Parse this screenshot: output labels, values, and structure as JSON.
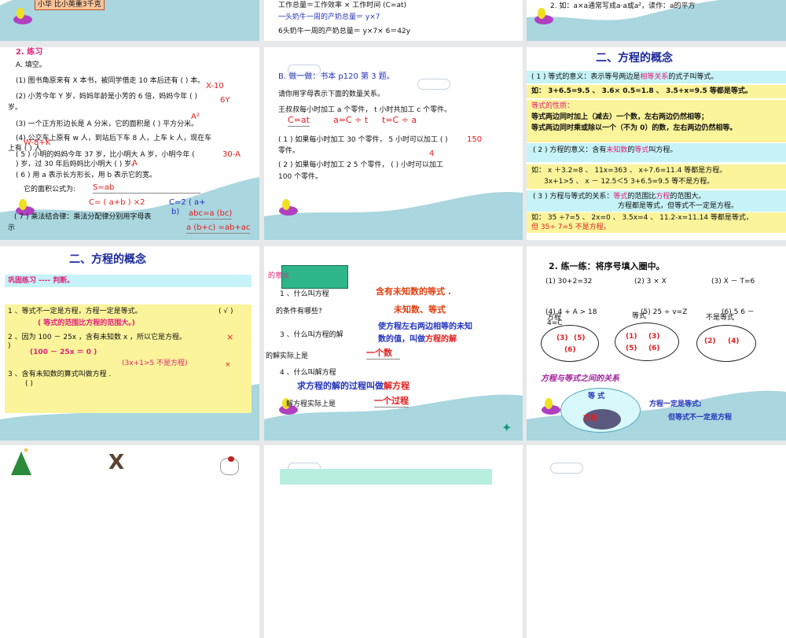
{
  "colors": {
    "wave": "#a9d6df",
    "background": "#e6e8e9",
    "cyan_band": "#c6f3f7",
    "yellow_band": "#fbf49a",
    "red": "#e02020",
    "blue": "#2233bb",
    "pink": "#e0207a"
  },
  "top_row": {
    "s1": {
      "box": "小华 比小英重3千克"
    },
    "s2": {
      "l1": "工作总量＝工作效率 × 工作时间 (C=at)",
      "l2": "一头奶牛一周的产奶总量＝  y×7",
      "l3": "6头奶牛一周的产奶总量＝  y×7× 6＝42y"
    },
    "s3": {
      "l1": "2. 如：a×a通常写成a·a或a²，读作：a的平方"
    }
  },
  "slide_practice": {
    "heading": "2. 练习",
    "sub": "A. 填空。",
    "q1": "(1) 图书角原来有 X 本书，被同学借走 10 本后还有 (        ) 本。",
    "q2": "(2) 小芳今年 Y 岁，妈妈年龄是小芳的 6 倍，妈妈今年 (       )",
    "q2b": "岁。",
    "q3": "(3) 一个正方形边长是     A 分米，它的面积是 (      ) 平方分米。",
    "q4": "(4) 公交车上原有 w 人，到站后下车 8 人，上车 k 人，现在车",
    "q4b": "上有 (              ) 人",
    "q5": "( 5 ) 小明的妈妈今年 37 岁，比小明大 A 岁，小明今年 (",
    "q5b": ") 岁，过 30 年后妈妈比小明大 (          ) 岁。",
    "q6": "( 6 ) 用 a 表示长方形长，用      b 表示它的宽。",
    "q6b": "它的面积公式为:",
    "q7": "( 7 ) 乘法结合律：乘法分配律分别用字母表",
    "q7b": "示",
    "answers": {
      "a1": "X-10",
      "a2": "6Y",
      "a3": "A²",
      "a4": "W-8+K",
      "a5": "30-A",
      "a5b": "A",
      "a6": "S=ab",
      "a6b": "C= ( a+b ) ×2",
      "a6c": "C=2 ( a+",
      "a6d": "b)",
      "a7": "abc=a (bc)",
      "a7b": "a (b+c) =ab+ac"
    }
  },
  "slide_do": {
    "heading": "B. 做一做：书本 p120 第 3 题。",
    "l1": "请你用字母表示下面的数量关系。",
    "l2": "王叔叔每小时加工 a 个零件， t 小时共加工 c 个零件。",
    "formulas": [
      "C=at",
      "a=C ÷ t",
      "t=C ÷ a"
    ],
    "q1": "( 1 ) 如果每小时加工 30 个零件， 5 小时可以加工 (        )",
    "q1b": "零件。",
    "q2": "( 2 ) 如果每小时加工 2 5 个零件， (      ) 小时可以加工",
    "q2b": "100 个零件。",
    "a1": "150",
    "a2": "4"
  },
  "slide_concept": {
    "title": "二、方程的概念",
    "p1a": "( 1 ) 等式的意义：表示等号两边是",
    "p1b": "相等关系",
    "p1c": "的式子叫等式。",
    "ex1": "如： 3+6.5=9.5 、   3.6× 0.5=1.8 、   3.5+x=9.5 等都是等式。",
    "prop_title": "等式的性质：",
    "prop1": "等式两边同时加上（减去）一个数，左右两边仍然相等；",
    "prop2": "等式两边同时乘或除以一个（不为 0）的数，左右两边仍然相等。",
    "p2a": "( 2 ) 方程的意义：含有",
    "p2b": "未知数",
    "p2c": "的",
    "p2d": "等式",
    "p2e": "叫方程。",
    "ex2": "如： x ＋3.2=8 、  11x=363 、 x÷7.6=11.4 等都是方程。",
    "ex2b": "3x+1>5  、   x － 12.5＜5        3+6.5=9.5 等不是方程。",
    "p3a": "( 3 ) 方程与等式的关系：",
    "p3b": "等式",
    "p3c": "的范围比",
    "p3d": "方程",
    "p3e": "的范围大。",
    "p3f": "方程都是等式，但等式不一定是方程。",
    "ex3": "如： 35 ÷7=5 、 2x=0 、  3.5x=4 、 11.2-x=11.14 等都是等式，",
    "ex3b": "但   35÷ 7=5    不是方程。"
  },
  "slide_judge": {
    "title": "二、方程的概念",
    "band": "巩固练习 ---- 判断。",
    "i1": "1 、等式不一定是方程，方程一定是等式。",
    "i1mark": "(  √  )",
    "i1note": "( 等式的范围比方程的范围大。)",
    "i2": "2 、因为 100 － 25x ，含有未知数 x ，所以它是方程。",
    "i2b": ")",
    "i2mark": "×",
    "i2note": "(100 － 25x ＝ 0   )",
    "i3note": "(3x+1>5 不是方程)",
    "i3mark": "×",
    "i3": "3 、含有未知数的算式叫做方程    .",
    "i3b": "(          )"
  },
  "slide_meaning": {
    "scroll_label": "的意义",
    "q1": "1 、什么叫方程",
    "a1": "含有未知数的等式 .",
    "q2": "的条件有哪些?",
    "a2": "未知数、等式",
    "q3": "3 、什么叫方程的解",
    "a3a": "使方程左右两边相等的未知",
    "a3b": "数的值，叫做",
    "a3c": "方程的解",
    "q3b": "的解实际上是",
    "a3d": "一个数",
    "q4": "4 、什么叫解方程",
    "a4a": "求方程的解的过程叫做",
    "a4b": "解方程",
    "q4b": "解方程实际上是",
    "a4c": "一个过程"
  },
  "slide_exercise": {
    "heading": "2. 练一练：将序号填入圈中。",
    "e1": "(1)  30+2=32",
    "e2": "(2)  3 × X",
    "e3": "(3)  X  －  T=6",
    "e4": "(4)  4  +  A  >  18",
    "e5": "(5)  25 ÷ v=Z",
    "e6": "(6)  5  6  －",
    "e6b": "4=C",
    "label1": "方程",
    "label2": "等式",
    "label3": "不是等式",
    "set1": [
      "(3)",
      "(5)",
      "(6)"
    ],
    "set2": [
      "(1)",
      "(3)",
      "(5)",
      "(6)"
    ],
    "set3": [
      "(2)",
      "(4)"
    ],
    "relation": "方程与等式之间的关系",
    "outer": "等 式",
    "inner": "方程",
    "note1": "方程一定是等式;",
    "note2": "但等式不一定是方程"
  }
}
